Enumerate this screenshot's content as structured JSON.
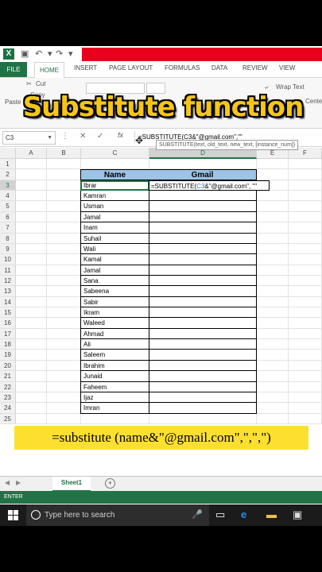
{
  "title_bar": {
    "app_icon": "X"
  },
  "ribbon_tabs": [
    "FILE",
    "HOME",
    "INSERT",
    "PAGE LAYOUT",
    "FORMULAS",
    "DATA",
    "REVIEW",
    "VIEW"
  ],
  "ribbon": {
    "cut": "Cut",
    "copy": "Copy",
    "paste": "Paste",
    "wrap_text": "Wrap Text",
    "center": "Center"
  },
  "banner_title": "Substitute function",
  "formula_bar": {
    "name_box": "C3",
    "fx": "fx",
    "formula": "=SUBSTITUTE(C3&\"@gmail.com\",\"\""
  },
  "columns": [
    "A",
    "B",
    "C",
    "D",
    "E",
    "F"
  ],
  "rows": [
    "1",
    "2",
    "3",
    "4",
    "5",
    "6",
    "7",
    "8",
    "9",
    "10",
    "11",
    "12",
    "13",
    "14",
    "15",
    "16",
    "17",
    "18",
    "19",
    "20",
    "21",
    "22",
    "23",
    "24",
    "25"
  ],
  "table": {
    "headers": [
      "Name",
      "Gmail"
    ],
    "names": [
      "Ibrar",
      "Kamran",
      "Usman",
      "Jamal",
      "Inam",
      "Suhail",
      "Wali",
      "Kamal",
      "Jamal",
      "Sana",
      "Sabeena",
      "Sabir",
      "Ikram",
      "Waleed",
      "Ahmad",
      "Ali",
      "Saleem",
      "Ibrahim",
      "Junaid",
      "Faheem",
      "Ijaz",
      "Imran"
    ]
  },
  "editing_cell": {
    "prefix": "=SUBSTITUTE(",
    "ref": "C3",
    "suffix": "&\"@gmail.com\", \"\""
  },
  "tooltip": "SUBSTITUTE(text, old_text, new_text, [instance_num])",
  "formula_banner": "=substitute (name&\"@gmail.com\",\",\",\")",
  "sheet_tab": "Sheet1",
  "status": "ENTER",
  "taskbar": {
    "search_placeholder": "Type here to search"
  },
  "colors": {
    "excel_green": "#217346",
    "header_fill": "#9dc3e6",
    "banner_yellow": "#fde02f",
    "title_yellow": "#f5c518",
    "red_bar": "#e8001c"
  }
}
